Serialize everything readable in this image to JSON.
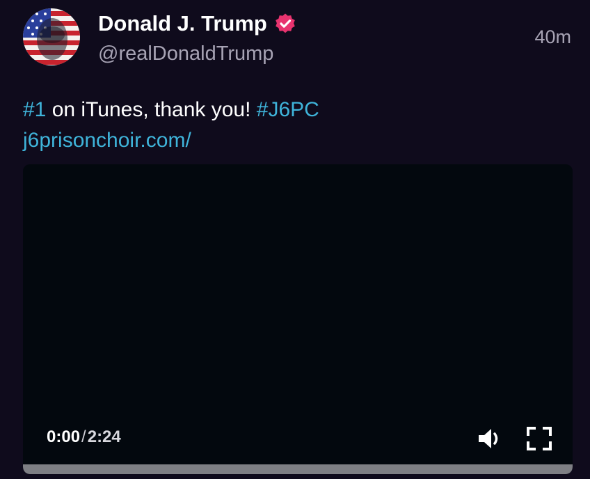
{
  "post": {
    "author": {
      "display_name": "Donald J. Trump",
      "handle": "@realDonaldTrump",
      "verified": true,
      "verified_badge_icon": "verified-badge-icon",
      "verified_color": "#e8336f"
    },
    "timestamp": "40m",
    "text": {
      "hashtag_1": "#1",
      "body": " on iTunes, thank you! ",
      "hashtag_2": "#J6PC",
      "link": "j6prisonchoir.com/"
    },
    "link_color": "#3fb4da",
    "video": {
      "current_time": "0:00",
      "separator": "/",
      "duration": "2:24",
      "progress_fraction": 0.0,
      "volume_icon": "speaker-icon",
      "fullscreen_icon": "fullscreen-icon"
    }
  }
}
